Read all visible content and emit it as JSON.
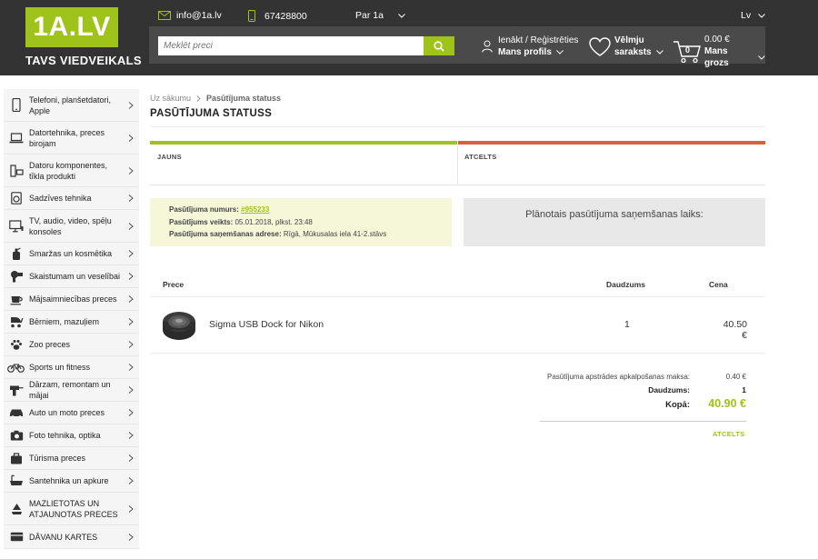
{
  "header": {
    "logo_main": "1A.LV",
    "logo_sub": "TAVS VIEDVEIKALS",
    "email": "info@1a.lv",
    "phone": "67428800",
    "about": "Par 1a",
    "language": "Lv",
    "search_placeholder": "Meklēt preci",
    "login_line1": "Ienākt / Reģistrēties",
    "login_line2": "Mans profils",
    "wishlist_line1": "Vēlmju",
    "wishlist_line2": "saraksts",
    "cart_count": "0",
    "cart_amount": "0.00 €",
    "cart_label": "Mans grozs",
    "colors": {
      "brand_green": "#9fc31a",
      "header_bg": "#333333",
      "cancel_orange": "#d9603b"
    }
  },
  "sidebar": {
    "items": [
      {
        "label": "Telefoni, planšetdatori, Apple",
        "icon": "phone-icon"
      },
      {
        "label": "Datortehnika, preces birojam",
        "icon": "laptop-icon"
      },
      {
        "label": "Datoru komponentes, tīkla produkti",
        "icon": "pc-components-icon"
      },
      {
        "label": "Sadzīves tehnika",
        "icon": "washing-machine-icon"
      },
      {
        "label": "TV, audio, video, spēļu konsoles",
        "icon": "tv-icon"
      },
      {
        "label": "Smaržas un kosmētika",
        "icon": "perfume-icon"
      },
      {
        "label": "Skaistumam un veselībai",
        "icon": "hairdryer-icon"
      },
      {
        "label": "Mājsaimniecības preces",
        "icon": "cup-icon"
      },
      {
        "label": "Bērniem, mazuļiem",
        "icon": "stroller-icon"
      },
      {
        "label": "Zoo preces",
        "icon": "paw-icon"
      },
      {
        "label": "Sports un fitness",
        "icon": "bicycle-icon"
      },
      {
        "label": "Dārzam, remontam un mājai",
        "icon": "drill-icon"
      },
      {
        "label": "Auto un moto preces",
        "icon": "car-icon"
      },
      {
        "label": "Foto tehnika, optika",
        "icon": "camera-icon"
      },
      {
        "label": "Tūrisma preces",
        "icon": "suitcase-icon"
      },
      {
        "label": "Santehnika un apkure",
        "icon": "bathtub-icon"
      },
      {
        "label": "MAZLIETOTAS UN ATJAUNOTAS PRECES",
        "icon": "recycle-icon"
      },
      {
        "label": "DĀVANU KARTES",
        "icon": "gift-card-icon"
      }
    ]
  },
  "main": {
    "breadcrumb": {
      "home": "Uz sākumu",
      "current": "Pasūtījuma statuss"
    },
    "title": "PASŪTĪJUMA STATUSS",
    "status": {
      "left": "JAUNS",
      "right": "ATCELTS"
    },
    "order_info": {
      "number_label": "Pasūtījuma numurs:",
      "number_value": "#955233",
      "made_label": "Pasūtījums veikts:",
      "made_value": "05.01.2018, plkst. 23:48",
      "address_label": "Pasūtījuma saņemšanas adrese:",
      "address_value": "Rīgā, Mūkusalas iela 41-2.stāvs"
    },
    "pickup_time_label": "Plānotais pasūtījuma saņemšanas laiks:",
    "table_headers": {
      "product": "Prece",
      "quantity": "Daudzums",
      "price": "Cena"
    },
    "items": [
      {
        "name": "Sigma USB Dock for Nikon",
        "quantity": "1",
        "price": "40.50 €"
      }
    ],
    "totals": {
      "fee_label": "Pasūtījuma apstrādes apkalpošanas maksa:",
      "fee_value": "0.40 €",
      "qty_label": "Daudzums:",
      "qty_value": "1",
      "total_label": "Kopā:",
      "total_value": "40.90 €"
    },
    "cancel_label": "ATCELTS"
  }
}
